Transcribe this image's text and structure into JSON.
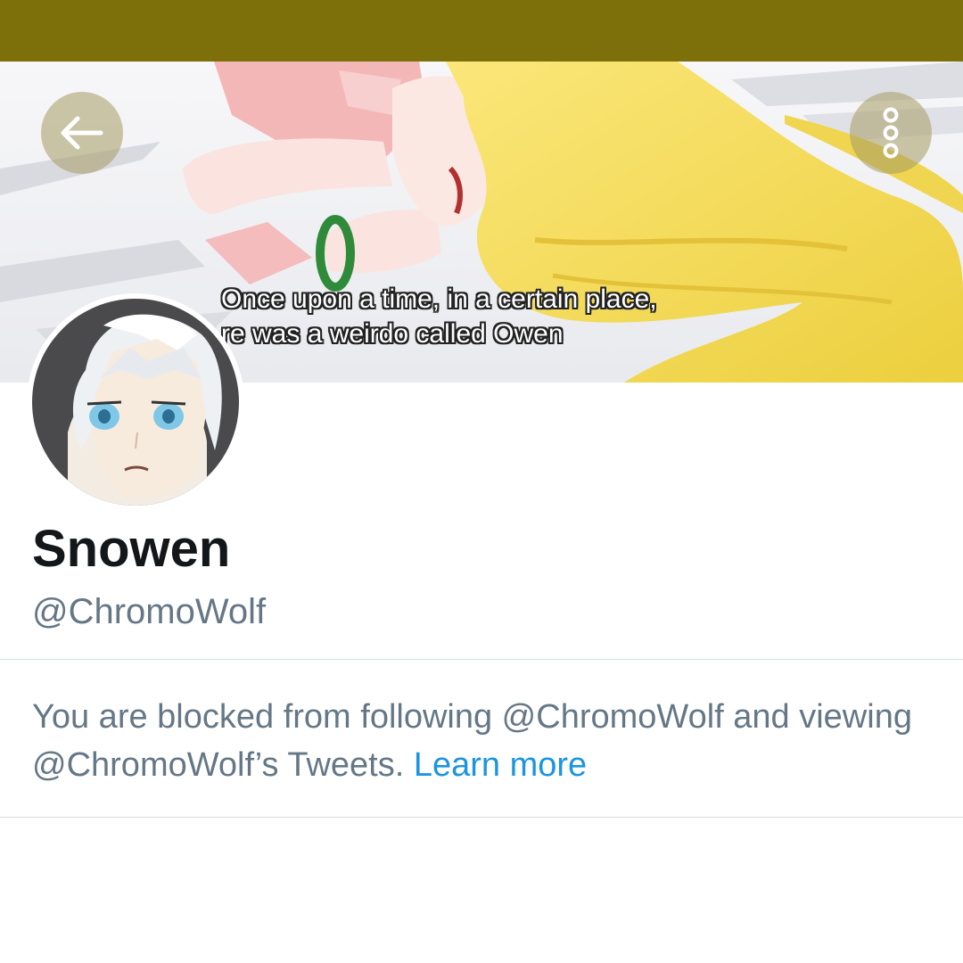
{
  "status_bar": {
    "color": "#7d700a"
  },
  "header": {
    "banner_subtitle_line1": "Once upon a time, in a certain place,",
    "banner_subtitle_line2": "re was a weirdo called Owen",
    "back_icon": "arrow-left-icon",
    "more_icon": "vertical-dots-icon"
  },
  "profile": {
    "display_name": "Snowen",
    "handle": "@ChromoWolf"
  },
  "blocked_notice": {
    "text": "You are blocked from following @ChromoWolf and viewing @ChromoWolf’s Tweets.",
    "link_label": "Learn more",
    "link_color": "#1b95e0",
    "text_color": "#657786"
  }
}
